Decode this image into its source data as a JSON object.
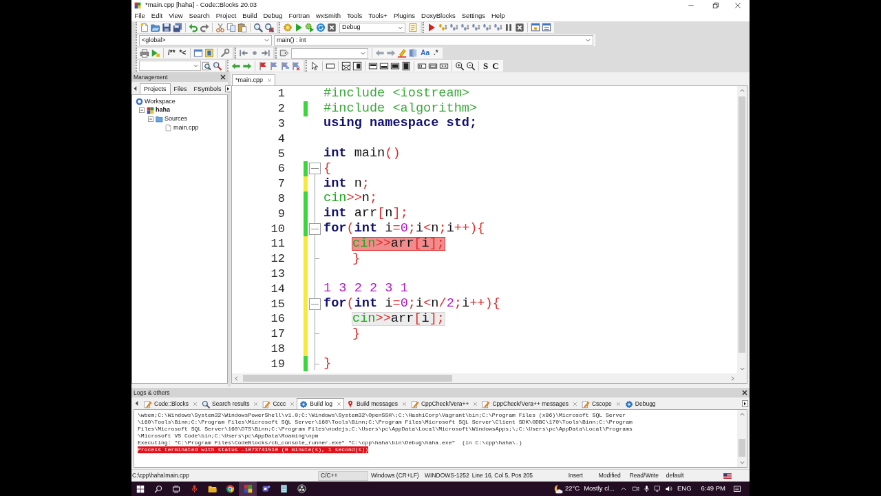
{
  "window": {
    "title": "*main.cpp [haha] - Code::Blocks 20.03"
  },
  "menu": [
    "File",
    "Edit",
    "View",
    "Search",
    "Project",
    "Build",
    "Debug",
    "Fortran",
    "wxSmith",
    "Tools",
    "Tools+",
    "Plugins",
    "DoxyBlocks",
    "Settings",
    "Help"
  ],
  "toolbars": {
    "build_target": "Debug",
    "scope": "<global>",
    "function": "main() : int",
    "doxy_buttons": [
      "/**",
      "*<"
    ],
    "search_options": [
      "Aa",
      ".*"
    ],
    "strip_buttons": [
      "S",
      "C"
    ]
  },
  "management": {
    "title": "Management",
    "tabs": [
      {
        "label": "Projects",
        "selected": true
      },
      {
        "label": "Files",
        "selected": false
      },
      {
        "label": "FSymbols",
        "selected": false
      }
    ],
    "tree": [
      {
        "label": "Workspace",
        "kind": "workspace",
        "children": [
          {
            "label": "haha",
            "kind": "project",
            "active": true,
            "expanded": true,
            "children": [
              {
                "label": "Sources",
                "kind": "folder",
                "expanded": true,
                "children": [
                  {
                    "label": "main.cpp",
                    "kind": "file"
                  }
                ]
              }
            ]
          }
        ]
      }
    ]
  },
  "editor": {
    "tabs": [
      {
        "label": "*main.cpp",
        "selected": true
      }
    ],
    "lines": [
      {
        "number": "1",
        "changed": false,
        "indented": false,
        "current": false,
        "error": false,
        "tokens": [
          {
            "kind": "preprocessor",
            "text": "#include <iostream>"
          }
        ]
      },
      {
        "number": "2",
        "changed": true,
        "saved": true,
        "indented": false,
        "current": false,
        "error": false,
        "tokens": [
          {
            "kind": "preprocessor",
            "text": "#include <algorithm>"
          }
        ]
      },
      {
        "number": "3",
        "changed": false,
        "indented": false,
        "current": false,
        "error": false,
        "tokens": [
          {
            "kind": "keyword",
            "text": "using namespace std;"
          }
        ]
      },
      {
        "number": "4",
        "changed": false
      },
      {
        "number": "5",
        "changed": false,
        "indented": false,
        "current": false,
        "error": false,
        "tokens": [
          {
            "kind": "keyword",
            "text": "int"
          },
          {
            "kind": "identifier",
            "text": " main"
          },
          {
            "kind": "operator",
            "text": "()"
          }
        ]
      },
      {
        "number": "6",
        "changed": true,
        "saved": true,
        "indented": false,
        "current": false,
        "error": false,
        "expanded": true,
        "tokens": [
          {
            "kind": "operator",
            "text": "{"
          }
        ]
      },
      {
        "number": "7",
        "changed": true,
        "saved": false,
        "indented": false,
        "current": false,
        "error": false,
        "tokens": [
          {
            "kind": "keyword",
            "text": "int"
          },
          {
            "kind": "identifier",
            "text": " n"
          },
          {
            "kind": "operator",
            "text": ";"
          }
        ]
      },
      {
        "number": "8",
        "changed": true,
        "saved": true,
        "indented": false,
        "current": false,
        "error": false,
        "tokens": [
          {
            "kind": "stream",
            "text": "cin"
          },
          {
            "kind": "operator",
            "text": ">>"
          },
          {
            "kind": "identifier",
            "text": "n"
          },
          {
            "kind": "operator",
            "text": ";"
          }
        ]
      },
      {
        "number": "9",
        "changed": true,
        "saved": true,
        "indented": false,
        "current": false,
        "error": false,
        "tokens": [
          {
            "kind": "keyword",
            "text": "int"
          },
          {
            "kind": "identifier",
            "text": " arr"
          },
          {
            "kind": "operator",
            "text": "["
          },
          {
            "kind": "identifier",
            "text": "n"
          },
          {
            "kind": "operator",
            "text": "];"
          }
        ]
      },
      {
        "number": "10",
        "changed": true,
        "saved": true,
        "indented": false,
        "current": false,
        "error": false,
        "expanded": true,
        "tokens": [
          {
            "kind": "keyword",
            "text": "for"
          },
          {
            "kind": "operator",
            "text": "("
          },
          {
            "kind": "keyword",
            "text": "int"
          },
          {
            "kind": "identifier",
            "text": " i"
          },
          {
            "kind": "operator",
            "text": "="
          },
          {
            "kind": "number",
            "text": "0"
          },
          {
            "kind": "operator",
            "text": ";"
          },
          {
            "kind": "identifier",
            "text": "i"
          },
          {
            "kind": "operator",
            "text": "<"
          },
          {
            "kind": "identifier",
            "text": "n"
          },
          {
            "kind": "operator",
            "text": ";"
          },
          {
            "kind": "identifier",
            "text": "i"
          },
          {
            "kind": "operator",
            "text": "++){"
          }
        ]
      },
      {
        "number": "11",
        "changed": true,
        "saved": false,
        "indented": true,
        "current": false,
        "error": true,
        "tokens": [
          {
            "kind": "stream",
            "text": "cin"
          },
          {
            "kind": "operator",
            "text": ">>"
          },
          {
            "kind": "identifier",
            "text": "arr"
          },
          {
            "kind": "operator",
            "text": "["
          },
          {
            "kind": "identifier",
            "text": "i"
          },
          {
            "kind": "operator",
            "text": "];"
          }
        ]
      },
      {
        "number": "12",
        "changed": true,
        "saved": false,
        "indented": true,
        "current": false,
        "error": false,
        "fold_end": true,
        "tokens": [
          {
            "kind": "operator",
            "text": "}"
          }
        ]
      },
      {
        "number": "13",
        "changed": true,
        "saved": false
      },
      {
        "number": "14",
        "changed": true,
        "saved": false,
        "indented": false,
        "current": false,
        "error": false,
        "tokens": [
          {
            "kind": "number",
            "text": "1 3 2 2 3 1"
          }
        ]
      },
      {
        "number": "15",
        "changed": true,
        "saved": false,
        "indented": false,
        "current": false,
        "error": false,
        "expanded": true,
        "tokens": [
          {
            "kind": "keyword",
            "text": "for"
          },
          {
            "kind": "operator",
            "text": "("
          },
          {
            "kind": "keyword",
            "text": "int"
          },
          {
            "kind": "identifier",
            "text": " i"
          },
          {
            "kind": "operator",
            "text": "="
          },
          {
            "kind": "number",
            "text": "0"
          },
          {
            "kind": "operator",
            "text": ";"
          },
          {
            "kind": "identifier",
            "text": "i"
          },
          {
            "kind": "operator",
            "text": "<"
          },
          {
            "kind": "identifier",
            "text": "n"
          },
          {
            "kind": "operator",
            "text": "/"
          },
          {
            "kind": "number",
            "text": "2"
          },
          {
            "kind": "operator",
            "text": ";"
          },
          {
            "kind": "identifier",
            "text": "i"
          },
          {
            "kind": "operator",
            "text": "++){"
          }
        ]
      },
      {
        "number": "16",
        "changed": true,
        "saved": false,
        "indented": true,
        "current": true,
        "error": false,
        "tokens": [
          {
            "kind": "stream",
            "text": "cin"
          },
          {
            "kind": "operator",
            "text": ">>"
          },
          {
            "kind": "identifier",
            "text": "arr"
          },
          {
            "kind": "operator",
            "text": "["
          },
          {
            "kind": "identifier",
            "text": "i"
          },
          {
            "kind": "operator",
            "text": "];"
          }
        ]
      },
      {
        "number": "17",
        "changed": true,
        "saved": false,
        "indented": true,
        "current": false,
        "error": false,
        "fold_end": true,
        "tokens": [
          {
            "kind": "operator",
            "text": "}"
          }
        ]
      },
      {
        "number": "18",
        "changed": true,
        "saved": false
      },
      {
        "number": "19",
        "changed": true,
        "saved": true,
        "indented": false,
        "current": false,
        "error": false,
        "fold_end": true,
        "tokens": [
          {
            "kind": "operator",
            "text": "}"
          }
        ]
      }
    ]
  },
  "logs": {
    "title": "Logs & others",
    "tabs": [
      {
        "label": "Code::Blocks",
        "selected": false
      },
      {
        "label": "Search results",
        "selected": false
      },
      {
        "label": "Cccc",
        "selected": false
      },
      {
        "label": "Build log",
        "selected": true
      },
      {
        "label": "Build messages",
        "selected": false
      },
      {
        "label": "CppCheck/Vera++",
        "selected": false
      },
      {
        "label": "CppCheck/Vera++ messages",
        "selected": false
      },
      {
        "label": "Cscope",
        "selected": false
      },
      {
        "label": "Debugg",
        "selected": false
      }
    ],
    "lines": [
      {
        "kind": "plain",
        "text": "\\wbem;C:\\Windows\\System32\\WindowsPowerShell\\v1.0;C:\\Windows\\System32\\OpenSSH\\;C:\\HashiCorp\\Vagrant\\bin;C:\\Program Files (x86)\\Microsoft SQL Server"
      },
      {
        "kind": "plain",
        "text": "\\160\\Tools\\Binn;C:\\Program Files\\Microsoft SQL Server\\160\\Tools\\Binn;C:\\Program Files\\Microsoft SQL Server\\Client SDK\\ODBC\\170\\Tools\\Binn;C:\\Program"
      },
      {
        "kind": "plain",
        "text": "Files\\Microsoft SQL Server\\160\\DTS\\Binn;C:\\Program Files\\nodejs;C:\\Users\\pc\\AppData\\Local\\Microsoft\\WindowsApps;\\;C:\\Users\\pc\\AppData\\Local\\Programs"
      },
      {
        "kind": "plain",
        "text": "\\Microsoft VS Code\\bin;C:\\Users\\pc\\AppData\\Roaming\\npm"
      },
      {
        "kind": "plain",
        "text": "Executing: \"C:\\Program Files\\CodeBlocks/cb_console_runner.exe\" \"C:\\cpp\\haha\\bin\\Debug\\haha.exe\"  (in C:\\cpp\\haha\\.)"
      },
      {
        "kind": "error",
        "text": "Process terminated with status -1073741510 (0 minute(s), 1 second(s))"
      }
    ]
  },
  "status_bar": {
    "path": "C:\\cpp\\haha\\main.cpp",
    "language": "C/C++",
    "line_ending": "Windows (CR+LF)",
    "encoding": "WINDOWS-1252",
    "position": "Line 16, Col 5, Pos 205",
    "mode": "Insert",
    "modified": "Modified",
    "access": "Read/Write",
    "theme": "default"
  },
  "taskbar": {
    "apps": [
      {
        "selected": false
      },
      {
        "selected": false
      },
      {
        "selected": false
      },
      {
        "selected": true
      },
      {
        "selected": false
      },
      {
        "selected": false
      },
      {
        "selected": false
      }
    ],
    "temperature": "22°C",
    "weather": "Mostly cl...",
    "language": "ENG",
    "time": "6:49 PM"
  }
}
